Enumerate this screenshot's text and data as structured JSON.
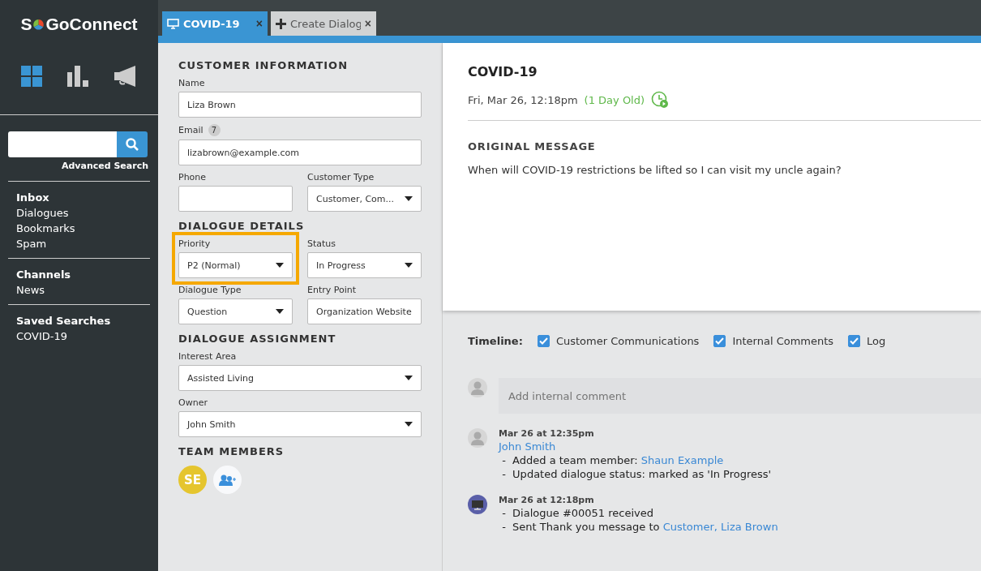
{
  "logo": {
    "start": "S",
    "end": "GoConnect"
  },
  "search": {
    "link": "Advanced Search"
  },
  "nav_groups": [
    {
      "items": [
        {
          "label": "Inbox",
          "heading": true
        },
        {
          "label": "Dialogues",
          "heading": false
        },
        {
          "label": "Bookmarks",
          "heading": false
        },
        {
          "label": "Spam",
          "heading": false
        }
      ]
    },
    {
      "items": [
        {
          "label": "Channels",
          "heading": true
        },
        {
          "label": "News",
          "heading": false
        }
      ]
    },
    {
      "items": [
        {
          "label": "Saved Searches",
          "heading": true
        },
        {
          "label": "COVID-19",
          "heading": false
        }
      ]
    }
  ],
  "tabs": [
    {
      "label": "COVID-19",
      "selected": true,
      "kind": "dialogue",
      "close": "×"
    },
    {
      "label": "Create Dialog",
      "selected": false,
      "kind": "create",
      "close": "×"
    }
  ],
  "form": [
    {
      "title": "CUSTOMER INFORMATION",
      "rows": [
        [
          {
            "label": "Name",
            "value": "Liza Brown",
            "kind": "text",
            "highlighted": false
          }
        ],
        [
          {
            "label": "Email",
            "badge": "7",
            "value": "lizabrown@example.com",
            "kind": "text",
            "highlighted": false
          }
        ],
        [
          {
            "label": "Phone",
            "kind": "text",
            "highlighted": false
          },
          {
            "label": "Customer Type",
            "value": "Customer, Com...",
            "kind": "select",
            "highlighted": false
          }
        ]
      ]
    },
    {
      "title": "DIALOGUE DETAILS",
      "rows": [
        [
          {
            "label": "Priority",
            "value": "P2 (Normal)",
            "kind": "select",
            "highlighted": true
          },
          {
            "label": "Status",
            "value": "In Progress",
            "kind": "select",
            "highlighted": false
          }
        ],
        [
          {
            "label": "Dialogue Type",
            "value": "Question",
            "kind": "select",
            "highlighted": false
          },
          {
            "label": "Entry Point",
            "value": "Organization Website",
            "kind": "text",
            "highlighted": false
          }
        ]
      ]
    },
    {
      "title": "DIALOGUE ASSIGNMENT",
      "rows": [
        [
          {
            "label": "Interest Area",
            "value": "Assisted Living",
            "kind": "select",
            "highlighted": false
          }
        ],
        [
          {
            "label": "Owner",
            "value": "John Smith",
            "kind": "select",
            "highlighted": false
          }
        ]
      ]
    }
  ],
  "team": {
    "title": "TEAM MEMBERS",
    "members": [
      {
        "initials": "SE",
        "color": "#e5c52e"
      }
    ]
  },
  "dialogue": {
    "title": "COVID-19",
    "date": "Fri, Mar 26, 12:18pm",
    "age": "(1 Day Old)",
    "message_heading": "ORIGINAL MESSAGE",
    "message": "When will COVID-19 restrictions be lifted so I can visit my uncle again?"
  },
  "timeline": {
    "label": "Timeline:",
    "filters": [
      {
        "label": "Customer Communications",
        "checked": true
      },
      {
        "label": "Internal Comments",
        "checked": true
      },
      {
        "label": "Log",
        "checked": true
      }
    ],
    "comment_placeholder": "Add internal comment",
    "entries": [
      {
        "kind": "user",
        "time": "Mar 26 at 12:35pm",
        "author": "John Smith",
        "lines": [
          {
            "bullet": "-",
            "text": "Added a team member: ",
            "link": "Shaun Example"
          },
          {
            "bullet": "-",
            "text": "Updated dialogue status: marked as 'In Progress'"
          }
        ]
      },
      {
        "kind": "system",
        "time": "Mar 26 at 12:18pm",
        "lines": [
          {
            "bullet": "-",
            "text": "Dialogue #00051 received"
          },
          {
            "bullet": "-",
            "text": "Sent Thank you message to ",
            "link": "Customer, Liza Brown"
          }
        ]
      }
    ]
  }
}
